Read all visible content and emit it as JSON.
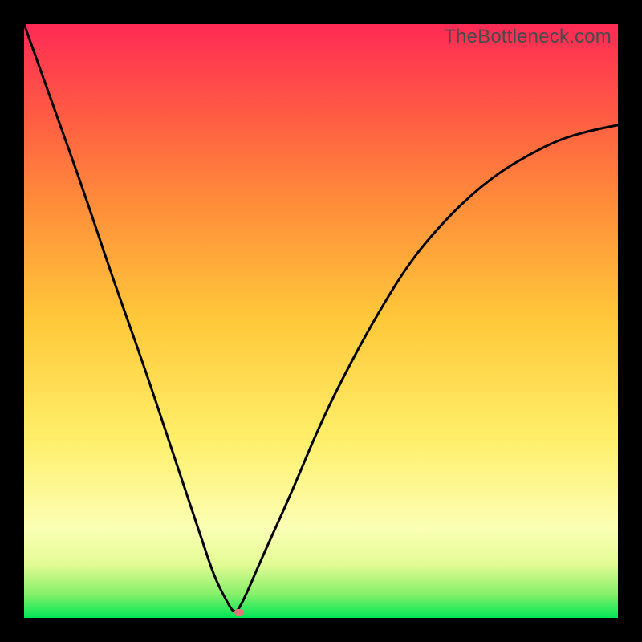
{
  "watermark": "TheBottleneck.com",
  "colors": {
    "frame": "#000000",
    "curve": "#000000",
    "marker": "#e07878",
    "gradient_top": "#ff2a55",
    "gradient_mid": "#ffef6a",
    "gradient_bottom": "#00e756"
  },
  "chart_data": {
    "type": "line",
    "title": "",
    "xlabel": "",
    "ylabel": "",
    "xlim": [
      0,
      100
    ],
    "ylim": [
      0,
      100
    ],
    "series": [
      {
        "name": "bottleneck-curve",
        "x": [
          0,
          5,
          10,
          15,
          20,
          25,
          28,
          30,
          32,
          34,
          35.5,
          37,
          40,
          45,
          50,
          55,
          60,
          65,
          70,
          75,
          80,
          85,
          90,
          95,
          100
        ],
        "y": [
          100,
          86,
          72,
          57,
          43,
          28,
          19,
          13,
          7,
          3,
          0.5,
          3,
          10,
          21,
          33,
          43,
          52,
          60,
          66,
          71,
          75,
          78,
          80.5,
          82,
          83
        ]
      }
    ],
    "marker": {
      "x": 36.2,
      "y": 1.0
    }
  }
}
